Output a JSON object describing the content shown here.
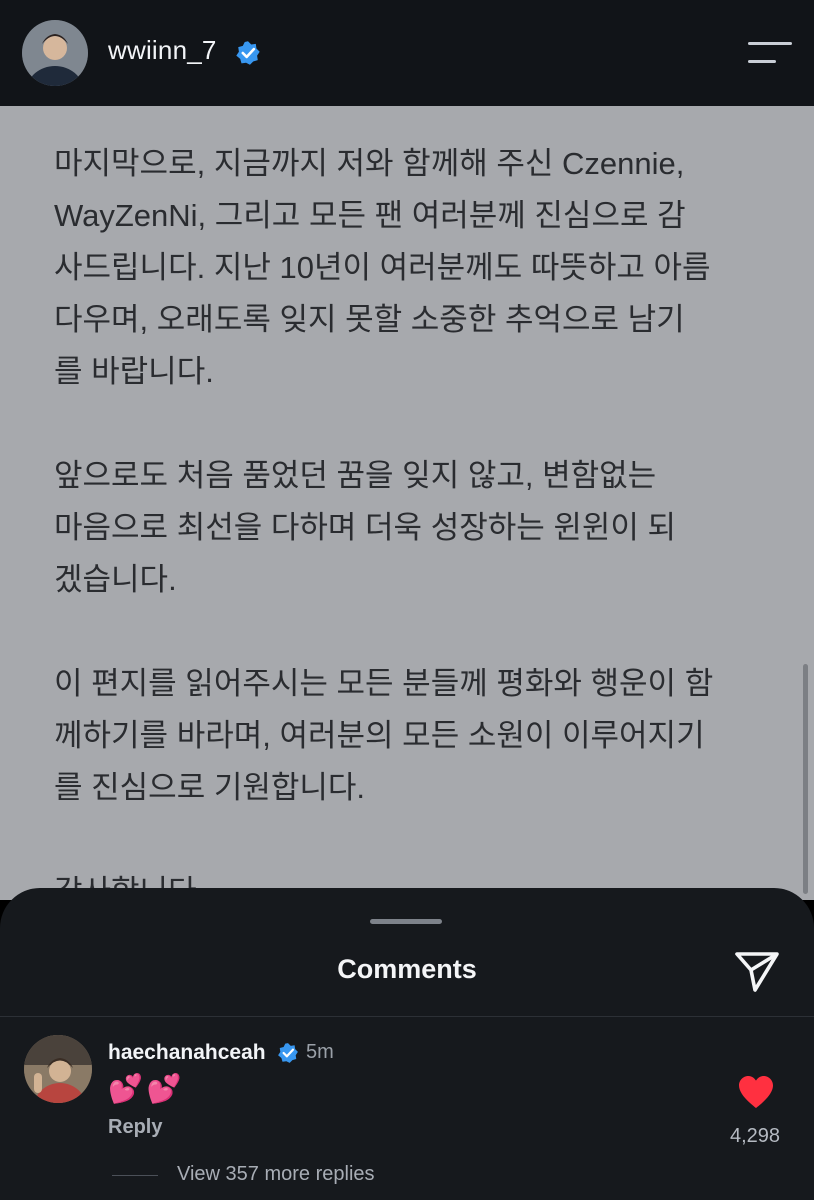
{
  "header": {
    "username": "wwiinn_7",
    "verified_icon": "verified-badge-icon",
    "menu_icon": "menu-icon"
  },
  "post": {
    "paragraphs": [
      [
        "마지막으로, 지금까지 저와 함께해 주신 Czennie,",
        "WayZenNi, 그리고 모든 팬 여러분께 진심으로 감",
        "사드립니다. 지난 10년이 여러분께도 따뜻하고 아름",
        "다우며, 오래도록 잊지 못할 소중한 추억으로 남기",
        "를 바랍니다."
      ],
      [
        "앞으로도 처음 품었던 꿈을 잊지 않고, 변함없는",
        "마음으로 최선을 다하며 더욱 성장하는 윈윈이 되",
        "겠습니다."
      ],
      [
        "이 편지를 읽어주시는 모든 분들께 평화와 행운이 함",
        "께하기를 바라며, 여러분의 모든 소원이 이루어지기",
        "를 진심으로 기원합니다."
      ],
      [
        "감사합니다."
      ]
    ]
  },
  "comments_sheet": {
    "title": "Comments",
    "share_icon": "send-icon",
    "comment": {
      "username": "haechanahceah",
      "time": "5m",
      "text": "💕💕",
      "reply_label": "Reply",
      "like_count": "4,298",
      "view_replies": "View 357 more replies"
    }
  },
  "colors": {
    "top_bar": "#111418",
    "content_bg": "#a7a9ad",
    "sheet_bg": "#16191d",
    "verified": "#3897f0",
    "heart": "#ff3040"
  }
}
